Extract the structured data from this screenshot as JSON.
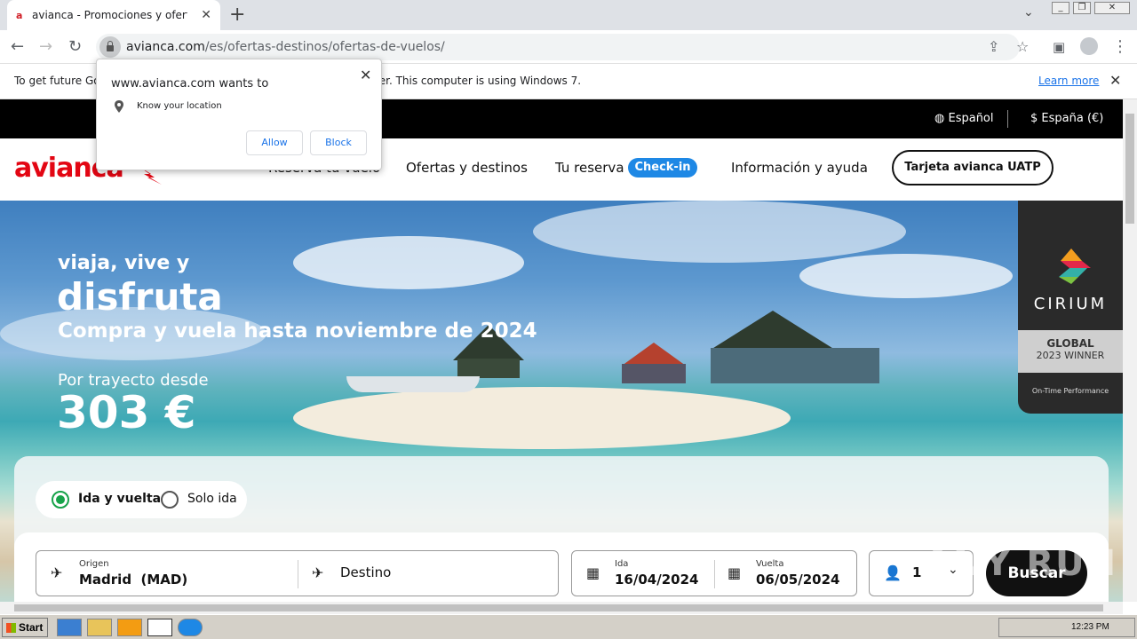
{
  "browser": {
    "tab_title": "avianca - Promociones y ofertas de vuelos",
    "favicon": "a",
    "url_host": "avianca.com",
    "url_path": "/es/ofertas-destinos/ofertas-de-vuelos/"
  },
  "infobar": {
    "message": "To get future Google Chrome updates, you'll need Windows 10 or later. This computer is using Windows 7.",
    "learn_more": "Learn more"
  },
  "permission_popup": {
    "title": "www.avianca.com wants to",
    "request": "Know your location",
    "allow": "Allow",
    "block": "Block"
  },
  "site": {
    "lang": "Español",
    "region": "España (€)",
    "logo": "avianca",
    "nav": {
      "reserve": "Reserva tu vuelo",
      "offers": "Ofertas y destinos",
      "booking": "Tu reserva",
      "checkin": "Check-in",
      "info": "Información y ayuda",
      "uatp": "Tarjeta avianca UATP"
    }
  },
  "hero": {
    "line1": "viaja, vive y",
    "line2": "disfruta",
    "line3": "Compra y vuela hasta noviembre de 2024",
    "from_label": "Por trayecto desde",
    "price": "303 €"
  },
  "badge": {
    "name": "CIRIUM",
    "global": "GLOBAL",
    "winner": "2023 WINNER",
    "perf": "On-Time Performance"
  },
  "booking": {
    "round_trip": "Ida y vuelta",
    "one_way": "Solo ida",
    "origin_label": "Origen",
    "origin_value": "Madrid  (MAD)",
    "destination_placeholder": "Destino",
    "depart_label": "Ida",
    "depart_value": "16/04/2024",
    "return_label": "Vuelta",
    "return_value": "06/05/2024",
    "passengers": "1",
    "search": "Buscar"
  },
  "taskbar": {
    "start": "Start",
    "time": "12:23 PM"
  },
  "watermark": "ANY RUN",
  "colors": {
    "brand_red": "#e30613",
    "checkin_blue": "#1e88e5",
    "radio_green": "#17a34a"
  }
}
